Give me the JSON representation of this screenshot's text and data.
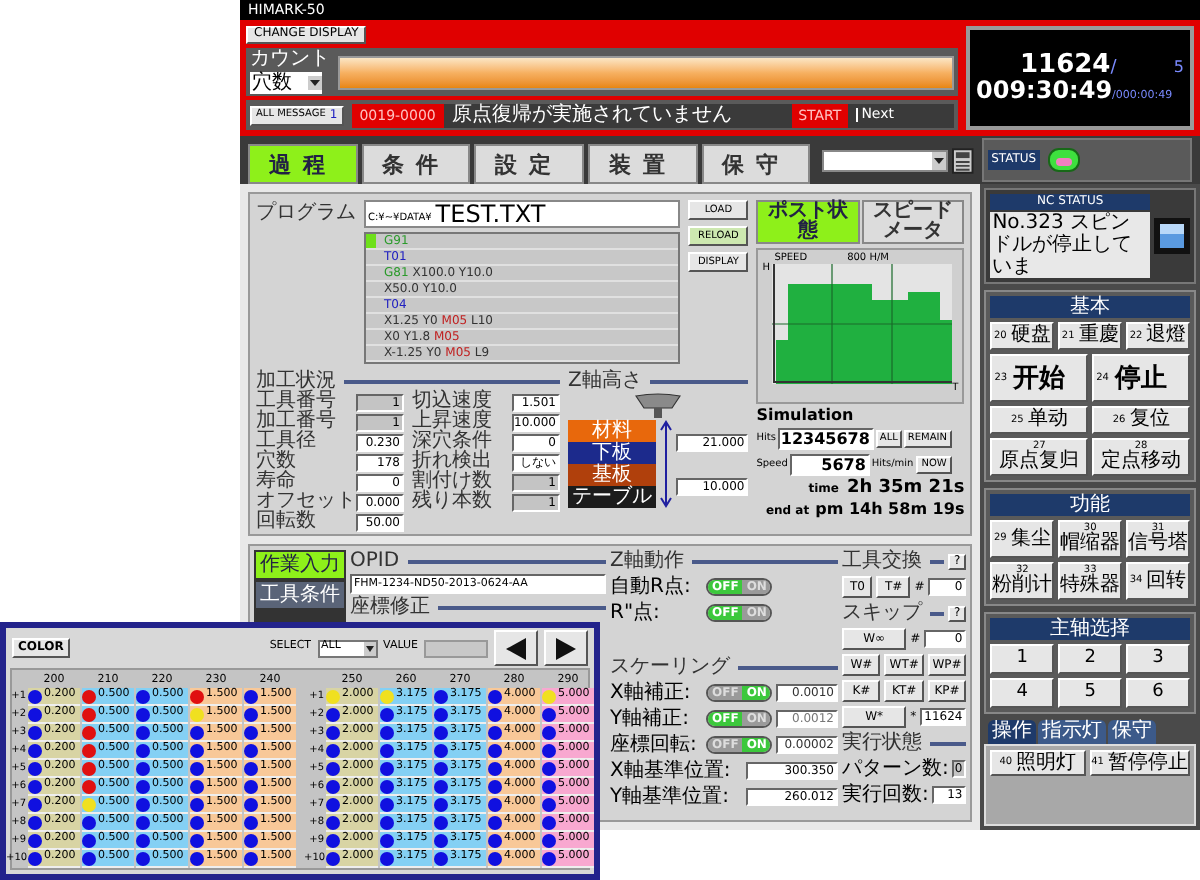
{
  "window": {
    "title": "HIMARK-50"
  },
  "header": {
    "change_display": "CHANGE DISPLAY",
    "count": {
      "label": "カウント",
      "select": "穴数",
      "level": 1
    },
    "counter": {
      "value": "11624",
      "separator": "/",
      "total": "5",
      "time": "009:30:49",
      "elapsed": "/000:00:49"
    },
    "message": {
      "button": "ALL MESSAGE",
      "count": "1",
      "code": "0019-0000",
      "text": "原点復帰が実施されていません",
      "action": "START",
      "next": "Next"
    }
  },
  "tabs": [
    {
      "label": "過程",
      "selected": true
    },
    {
      "label": "条件",
      "selected": false
    },
    {
      "label": "設定",
      "selected": false
    },
    {
      "label": "装置",
      "selected": false
    },
    {
      "label": "保守",
      "selected": false
    }
  ],
  "status": {
    "label": "STATUS"
  },
  "program": {
    "label": "プログラム",
    "path": "C:¥~¥DATA¥",
    "file": "TEST.TXT",
    "buttons": [
      {
        "label": "LOAD",
        "active": false
      },
      {
        "label": "RELOAD",
        "active": true
      },
      {
        "label": "DISPLAY",
        "active": false
      }
    ],
    "lines": [
      {
        "current": true,
        "segments": [
          {
            "text": "G91",
            "kind": "gcode"
          }
        ]
      },
      {
        "current": false,
        "segments": [
          {
            "text": "T01",
            "kind": "tool"
          }
        ]
      },
      {
        "current": false,
        "segments": [
          {
            "text": "G81",
            "kind": "gcode"
          },
          {
            "text": "X100.0 Y10.0",
            "kind": "coord"
          }
        ]
      },
      {
        "current": false,
        "segments": [
          {
            "text": "X50.0 Y10.0",
            "kind": "coord"
          }
        ]
      },
      {
        "current": false,
        "segments": [
          {
            "text": "T04",
            "kind": "tool"
          }
        ]
      },
      {
        "current": false,
        "segments": [
          {
            "text": "X1.25 Y0",
            "kind": "coord"
          },
          {
            "text": "M05",
            "kind": "mcode"
          },
          {
            "text": "L10",
            "kind": "coord"
          }
        ]
      },
      {
        "current": false,
        "segments": [
          {
            "text": "X0 Y1.8",
            "kind": "coord"
          },
          {
            "text": "M05",
            "kind": "mcode"
          }
        ]
      },
      {
        "current": false,
        "segments": [
          {
            "text": "X-1.25 Y0",
            "kind": "coord"
          },
          {
            "text": "M05",
            "kind": "mcode"
          },
          {
            "text": "L9",
            "kind": "coord"
          }
        ]
      }
    ]
  },
  "processing": {
    "title": "加工状況",
    "columns": [
      [
        {
          "label": "工具番号",
          "value": "1",
          "readonly": true
        },
        {
          "label": "加工番号",
          "value": "1",
          "readonly": true
        },
        {
          "label": "工具径",
          "value": "0.230",
          "readonly": false
        },
        {
          "label": "穴数",
          "value": "178",
          "readonly": false
        },
        {
          "label": "寿命",
          "value": "0",
          "readonly": false
        },
        {
          "label": "オフセット",
          "value": "0.000",
          "readonly": false
        },
        {
          "label": "回転数",
          "value": "50.00",
          "readonly": false
        }
      ],
      [
        {
          "label": "切込速度",
          "value": "1.501",
          "readonly": false
        },
        {
          "label": "上昇速度",
          "value": "10.000",
          "readonly": false
        },
        {
          "label": "深穴条件",
          "value": "0",
          "readonly": false
        },
        {
          "label": "折れ検出",
          "value": "しない",
          "readonly": false
        },
        {
          "label": "割付け数",
          "value": "1",
          "readonly": true
        },
        {
          "label": "残り本数",
          "value": "1",
          "readonly": true
        }
      ]
    ]
  },
  "z_height": {
    "title": "Z軸高さ",
    "layers": [
      {
        "label": "材料",
        "color": "#e8680c"
      },
      {
        "label": "下板",
        "color": "#1c2a8c"
      },
      {
        "label": "基板",
        "color": "#b0400c"
      },
      {
        "label": "テーブル",
        "color": "#1c1c1c"
      }
    ],
    "values": [
      "21.000",
      "10.000"
    ]
  },
  "post": {
    "tabs": [
      {
        "label": "ポスト状態",
        "selected": true
      },
      {
        "label": "スピードメータ",
        "selected": false
      }
    ],
    "chart": {
      "title": "SPEED",
      "unit": "800 H/M",
      "y_axis": "H",
      "x_axis": "T"
    },
    "simulation": {
      "title": "Simulation",
      "hits_label": "Hits",
      "hits": "12345678",
      "buttons": [
        "ALL",
        "REMAIN"
      ],
      "speed_label": "Speed",
      "speed": "5678",
      "speed_unit": "Hits/min",
      "now": "NOW",
      "time_label": "time",
      "time": "2h 35m 21s",
      "end_label": "end at",
      "end": "pm 14h 58m 19s"
    }
  },
  "nc_status": {
    "title": "NC STATUS",
    "message": "No.323 スピンドルが停止していま"
  },
  "groups": [
    {
      "title": "基本",
      "rows": [
        [
          {
            "number": "20",
            "label": "硬盘",
            "kind": "small"
          },
          {
            "number": "21",
            "label": "重慶",
            "kind": "small"
          },
          {
            "number": "22",
            "label": "退燈",
            "kind": "small"
          }
        ],
        [
          {
            "number": "23",
            "label": "开始",
            "kind": "large"
          },
          {
            "number": "24",
            "label": "停止",
            "kind": "large"
          }
        ],
        [
          {
            "number": "25",
            "label": "单动",
            "kind": "small"
          },
          {
            "number": "26",
            "label": "复位",
            "kind": "small"
          }
        ],
        [
          {
            "number": "27",
            "label": "原点复归",
            "kind": "small"
          },
          {
            "number": "28",
            "label": "定点移动",
            "kind": "small"
          }
        ]
      ]
    },
    {
      "title": "功能",
      "rows": [
        [
          {
            "number": "29",
            "label": "集尘",
            "kind": "small"
          },
          {
            "number": "30",
            "label": "帽缩器",
            "kind": "small"
          },
          {
            "number": "31",
            "label": "信号塔",
            "kind": "small"
          }
        ],
        [
          {
            "number": "32",
            "label": "粉削计",
            "kind": "small"
          },
          {
            "number": "33",
            "label": "特殊器",
            "kind": "small"
          },
          {
            "number": "34",
            "label": "回转",
            "kind": "small"
          }
        ]
      ]
    },
    {
      "title": "主轴选择",
      "rows": [
        [
          {
            "label": "1",
            "kind": "digit"
          },
          {
            "label": "2",
            "kind": "digit"
          },
          {
            "label": "3",
            "kind": "digit"
          }
        ],
        [
          {
            "label": "4",
            "kind": "digit"
          },
          {
            "label": "5",
            "kind": "digit"
          },
          {
            "label": "6",
            "kind": "digit"
          }
        ]
      ]
    }
  ],
  "panel_tabs": [
    {
      "label": "操作",
      "selected": true
    },
    {
      "label": "指示灯",
      "selected": false
    },
    {
      "label": "保守",
      "selected": false
    }
  ],
  "panel_buttons": [
    {
      "number": "40",
      "label": "照明灯"
    },
    {
      "number": "41",
      "label": "暂停停止"
    }
  ],
  "work": {
    "side_tabs": [
      {
        "label": "作業入力",
        "selected": true
      },
      {
        "label": "工具条件",
        "selected": false
      }
    ],
    "opid": {
      "title": "OPID",
      "value": "FHM-1234-ND50-2013-0624-AA"
    },
    "coord_title": "座標修正",
    "z_motion": {
      "title": "Z軸動作",
      "rows": [
        {
          "label": "自動R点:",
          "off_label": "OFF",
          "on_label": "ON",
          "on": false
        },
        {
          "label": "R\"点:",
          "off_label": "OFF",
          "on_label": "ON",
          "on": false
        }
      ]
    },
    "scaling": {
      "title": "スケーリング",
      "rows": [
        {
          "label": "X軸補正:",
          "off_label": "OFF",
          "on_label": "ON",
          "on": true,
          "value": "0.0010"
        },
        {
          "label": "Y軸補正:",
          "off_label": "OFF",
          "on_label": "ON",
          "on": false,
          "value": "0.0012"
        },
        {
          "label": "座標回転:",
          "off_label": "OFF",
          "on_label": "ON",
          "on": true,
          "value": "0.00002"
        }
      ],
      "positions": [
        {
          "label": "X軸基準位置:",
          "value": "300.350"
        },
        {
          "label": "Y軸基準位置:",
          "value": "260.012"
        }
      ]
    },
    "tool_change": {
      "title": "工具交換",
      "help": "?",
      "buttons": [
        "T0",
        "T#"
      ],
      "field_label": "#",
      "field": "0"
    },
    "skip": {
      "title": "スキップ",
      "help": "?",
      "rows": [
        [
          {
            "kind": "button",
            "label": "W∞"
          },
          {
            "kind": "field",
            "label": "#",
            "value": "0"
          }
        ],
        [
          {
            "kind": "button",
            "label": "W#"
          },
          {
            "kind": "button",
            "label": "WT#"
          },
          {
            "kind": "button",
            "label": "WP#"
          }
        ],
        [
          {
            "kind": "button",
            "label": "K#"
          },
          {
            "kind": "button",
            "label": "KT#"
          },
          {
            "kind": "button",
            "label": "KP#"
          }
        ],
        [
          {
            "kind": "button",
            "label": "W*"
          },
          {
            "kind": "field",
            "label": "*",
            "value": "11624"
          }
        ]
      ]
    },
    "run_state": {
      "title": "実行状態",
      "fields": [
        {
          "label": "パターン数:",
          "value": "0",
          "readonly": true
        },
        {
          "label": "実行回数:",
          "value": "13",
          "readonly": false
        }
      ]
    }
  },
  "inset": {
    "color_button": "COLOR",
    "select_label": "SELECT",
    "select": "ALL",
    "value_label": "VALUE",
    "tables": [
      {
        "row_labels": [
          "+1",
          "+2",
          "+3",
          "+4",
          "+5",
          "+6",
          "+7",
          "+8",
          "+9",
          "+10"
        ],
        "columns": [
          {
            "header": "200",
            "color": "#d8d4a4",
            "cells": [
              {
                "value": "0.200",
                "color": "#1010e0"
              },
              {
                "value": "0.200",
                "color": "#1010e0"
              },
              {
                "value": "0.200",
                "color": "#1010e0"
              },
              {
                "value": "0.200",
                "color": "#1010e0"
              },
              {
                "value": "0.200",
                "color": "#1010e0"
              },
              {
                "value": "0.200",
                "color": "#1010e0"
              },
              {
                "value": "0.200",
                "color": "#1010e0"
              },
              {
                "value": "0.200",
                "color": "#1010e0"
              },
              {
                "value": "0.200",
                "color": "#1010e0"
              },
              {
                "value": "0.200",
                "color": "#1010e0"
              }
            ]
          },
          {
            "header": "210",
            "color": "#84d0f4",
            "cells": [
              {
                "value": "0.500",
                "color": "#e01010"
              },
              {
                "value": "0.500",
                "color": "#e01010"
              },
              {
                "value": "0.500",
                "color": "#e01010"
              },
              {
                "value": "0.500",
                "color": "#e01010"
              },
              {
                "value": "0.500",
                "color": "#e01010"
              },
              {
                "value": "0.500",
                "color": "#e01010"
              },
              {
                "value": "0.500",
                "color": "#f0e020"
              },
              {
                "value": "0.500",
                "color": "#1010e0"
              },
              {
                "value": "0.500",
                "color": "#1010e0"
              },
              {
                "value": "0.500",
                "color": "#1010e0"
              }
            ]
          },
          {
            "header": "220",
            "color": "#84d0f4",
            "cells": [
              {
                "value": "0.500",
                "color": "#1010e0"
              },
              {
                "value": "0.500",
                "color": "#1010e0"
              },
              {
                "value": "0.500",
                "color": "#1010e0"
              },
              {
                "value": "0.500",
                "color": "#1010e0"
              },
              {
                "value": "0.500",
                "color": "#1010e0"
              },
              {
                "value": "0.500",
                "color": "#1010e0"
              },
              {
                "value": "0.500",
                "color": "#1010e0"
              },
              {
                "value": "0.500",
                "color": "#1010e0"
              },
              {
                "value": "0.500",
                "color": "#1010e0"
              },
              {
                "value": "0.500",
                "color": "#1010e0"
              }
            ]
          },
          {
            "header": "230",
            "color": "#f8c898",
            "cells": [
              {
                "value": "1.500",
                "color": "#e01010"
              },
              {
                "value": "1.500",
                "color": "#f0e020"
              },
              {
                "value": "1.500",
                "color": "#1010e0"
              },
              {
                "value": "1.500",
                "color": "#1010e0"
              },
              {
                "value": "1.500",
                "color": "#1010e0"
              },
              {
                "value": "1.500",
                "color": "#1010e0"
              },
              {
                "value": "1.500",
                "color": "#1010e0"
              },
              {
                "value": "1.500",
                "color": "#1010e0"
              },
              {
                "value": "1.500",
                "color": "#1010e0"
              },
              {
                "value": "1.500",
                "color": "#1010e0"
              }
            ]
          },
          {
            "header": "240",
            "color": "#f8c898",
            "cells": [
              {
                "value": "1.500",
                "color": "#1010e0"
              },
              {
                "value": "1.500",
                "color": "#1010e0"
              },
              {
                "value": "1.500",
                "color": "#1010e0"
              },
              {
                "value": "1.500",
                "color": "#1010e0"
              },
              {
                "value": "1.500",
                "color": "#1010e0"
              },
              {
                "value": "1.500",
                "color": "#1010e0"
              },
              {
                "value": "1.500",
                "color": "#1010e0"
              },
              {
                "value": "1.500",
                "color": "#1010e0"
              },
              {
                "value": "1.500",
                "color": "#1010e0"
              },
              {
                "value": "1.500",
                "color": "#1010e0"
              }
            ]
          }
        ]
      },
      {
        "row_labels": [
          "+1",
          "+2",
          "+3",
          "+4",
          "+5",
          "+6",
          "+7",
          "+8",
          "+9",
          "+10"
        ],
        "columns": [
          {
            "header": "250",
            "color": "#d8d4a4",
            "cells": [
              {
                "value": "2.000",
                "color": "#f0e020"
              },
              {
                "value": "2.000",
                "color": "#1010e0"
              },
              {
                "value": "2.000",
                "color": "#1010e0"
              },
              {
                "value": "2.000",
                "color": "#1010e0"
              },
              {
                "value": "2.000",
                "color": "#1010e0"
              },
              {
                "value": "2.000",
                "color": "#1010e0"
              },
              {
                "value": "2.000",
                "color": "#1010e0"
              },
              {
                "value": "2.000",
                "color": "#1010e0"
              },
              {
                "value": "2.000",
                "color": "#1010e0"
              },
              {
                "value": "2.000",
                "color": "#1010e0"
              }
            ]
          },
          {
            "header": "260",
            "color": "#84d0f4",
            "cells": [
              {
                "value": "3.175",
                "color": "#f0e020"
              },
              {
                "value": "3.175",
                "color": "#1010e0"
              },
              {
                "value": "3.175",
                "color": "#1010e0"
              },
              {
                "value": "3.175",
                "color": "#1010e0"
              },
              {
                "value": "3.175",
                "color": "#1010e0"
              },
              {
                "value": "3.175",
                "color": "#1010e0"
              },
              {
                "value": "3.175",
                "color": "#1010e0"
              },
              {
                "value": "3.175",
                "color": "#1010e0"
              },
              {
                "value": "3.175",
                "color": "#1010e0"
              },
              {
                "value": "3.175",
                "color": "#1010e0"
              }
            ]
          },
          {
            "header": "270",
            "color": "#84d0f4",
            "cells": [
              {
                "value": "3.175",
                "color": "#1010e0"
              },
              {
                "value": "3.175",
                "color": "#1010e0"
              },
              {
                "value": "3.175",
                "color": "#1010e0"
              },
              {
                "value": "3.175",
                "color": "#1010e0"
              },
              {
                "value": "3.175",
                "color": "#1010e0"
              },
              {
                "value": "3.175",
                "color": "#1010e0"
              },
              {
                "value": "3.175",
                "color": "#1010e0"
              },
              {
                "value": "3.175",
                "color": "#1010e0"
              },
              {
                "value": "3.175",
                "color": "#1010e0"
              },
              {
                "value": "3.175",
                "color": "#1010e0"
              }
            ]
          },
          {
            "header": "280",
            "color": "#f8c898",
            "cells": [
              {
                "value": "4.000",
                "color": "#1010e0"
              },
              {
                "value": "4.000",
                "color": "#1010e0"
              },
              {
                "value": "4.000",
                "color": "#1010e0"
              },
              {
                "value": "4.000",
                "color": "#1010e0"
              },
              {
                "value": "4.000",
                "color": "#1010e0"
              },
              {
                "value": "4.000",
                "color": "#1010e0"
              },
              {
                "value": "4.000",
                "color": "#1010e0"
              },
              {
                "value": "4.000",
                "color": "#1010e0"
              },
              {
                "value": "4.000",
                "color": "#1010e0"
              },
              {
                "value": "4.000",
                "color": "#1010e0"
              }
            ]
          },
          {
            "header": "290",
            "color": "#f8a8d0",
            "cells": [
              {
                "value": "5.000",
                "color": "#f0e020"
              },
              {
                "value": "5.000",
                "color": "#1010e0"
              },
              {
                "value": "5.000",
                "color": "#1010e0"
              },
              {
                "value": "5.000",
                "color": "#1010e0"
              },
              {
                "value": "5.000",
                "color": "#1010e0"
              },
              {
                "value": "5.000",
                "color": "#1010e0"
              },
              {
                "value": "5.000",
                "color": "#1010e0"
              },
              {
                "value": "5.000",
                "color": "#1010e0"
              },
              {
                "value": "5.000",
                "color": "#1010e0"
              },
              {
                "value": "5.000",
                "color": "#1010e0"
              }
            ]
          }
        ]
      }
    ]
  }
}
